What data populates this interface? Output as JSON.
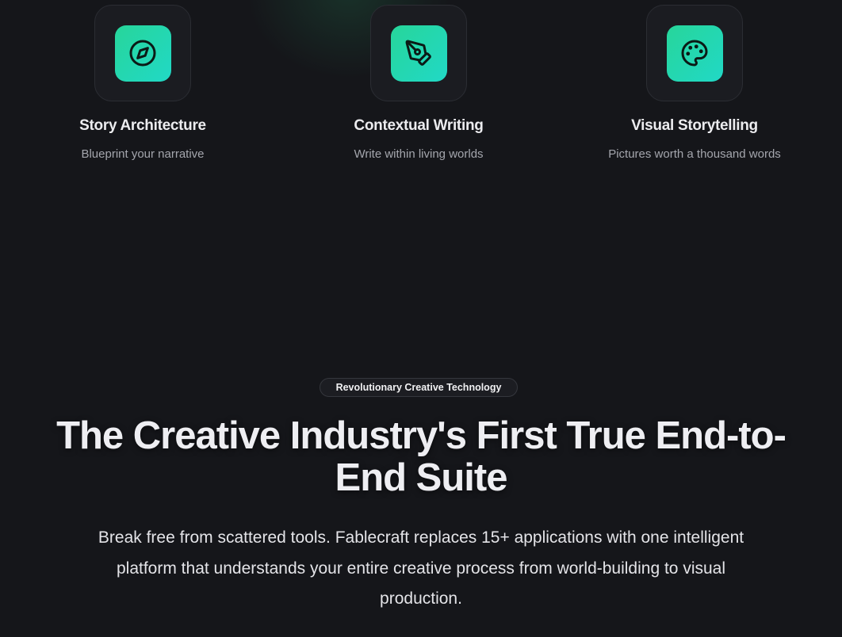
{
  "colors": {
    "background": "#15161a",
    "accent_start": "#27d69a",
    "accent_end": "#21d8c6",
    "heading": "#eeeef2",
    "muted_text": "#a4a6ad"
  },
  "features": [
    {
      "icon": "compass-icon",
      "title": "Story Architecture",
      "description": "Blueprint your narrative"
    },
    {
      "icon": "pen-tool-icon",
      "title": "Contextual Writing",
      "description": "Write within living worlds"
    },
    {
      "icon": "palette-icon",
      "title": "Visual Storytelling",
      "description": "Pictures worth a thousand words"
    }
  ],
  "hero": {
    "badge": "Revolutionary Creative Technology",
    "headline": "The Creative Industry's First True End-to-End Suite",
    "subtext": "Break free from scattered tools. Fablecraft replaces 15+ applications with one intelligent platform that understands your entire creative process from world-building to visual production."
  }
}
